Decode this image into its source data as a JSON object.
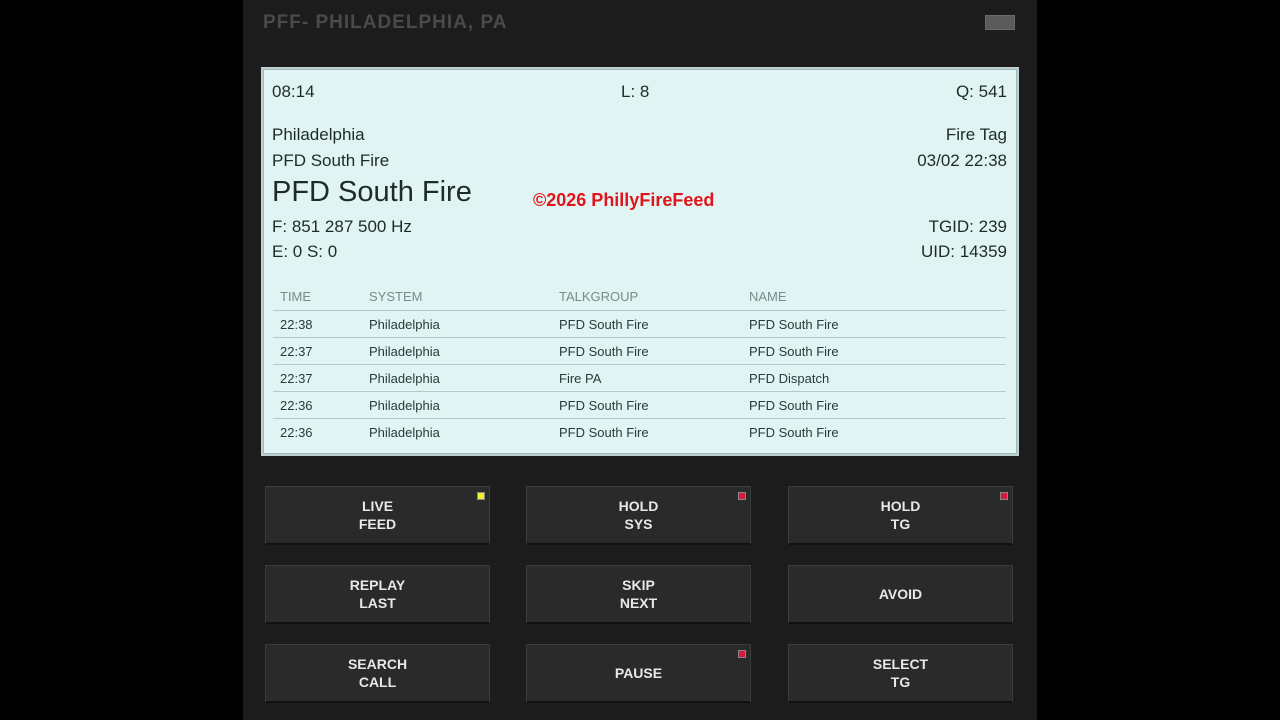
{
  "app": {
    "title": "PFF- PHILADELPHIA, PA"
  },
  "display": {
    "time": "08:14",
    "listeners": "L: 8",
    "queue": "Q: 541",
    "system": "Philadelphia",
    "tag": "Fire Tag",
    "talkgroup": "PFD South Fire",
    "datetime": "03/02 22:38",
    "name_large": "PFD South Fire",
    "watermark": "©2026 PhillyFireFeed",
    "frequency": "F: 851 287 500 Hz",
    "tgid": "TGID: 239",
    "errors": "E: 0 S: 0",
    "uid": "UID: 14359"
  },
  "history": {
    "headers": [
      "TIME",
      "SYSTEM",
      "TALKGROUP",
      "NAME"
    ],
    "rows": [
      [
        "22:38",
        "Philadelphia",
        "PFD South Fire",
        "PFD South Fire"
      ],
      [
        "22:37",
        "Philadelphia",
        "PFD South Fire",
        "PFD South Fire"
      ],
      [
        "22:37",
        "Philadelphia",
        "Fire PA",
        "PFD Dispatch"
      ],
      [
        "22:36",
        "Philadelphia",
        "PFD South Fire",
        "PFD South Fire"
      ],
      [
        "22:36",
        "Philadelphia",
        "PFD South Fire",
        "PFD South Fire"
      ]
    ]
  },
  "buttons": {
    "live_feed": "LIVE\nFEED",
    "hold_sys": "HOLD\nSYS",
    "hold_tg": "HOLD\nTG",
    "replay_last": "REPLAY\nLAST",
    "skip_next": "SKIP\nNEXT",
    "avoid": "AVOID",
    "search_call": "SEARCH\nCALL",
    "pause": "PAUSE",
    "select_tg": "SELECT\nTG"
  },
  "colors": {
    "display_bg": "#dff4f3",
    "watermark": "#e2141b",
    "led_on": "#f2f22a",
    "led_off": "#d6183a"
  }
}
